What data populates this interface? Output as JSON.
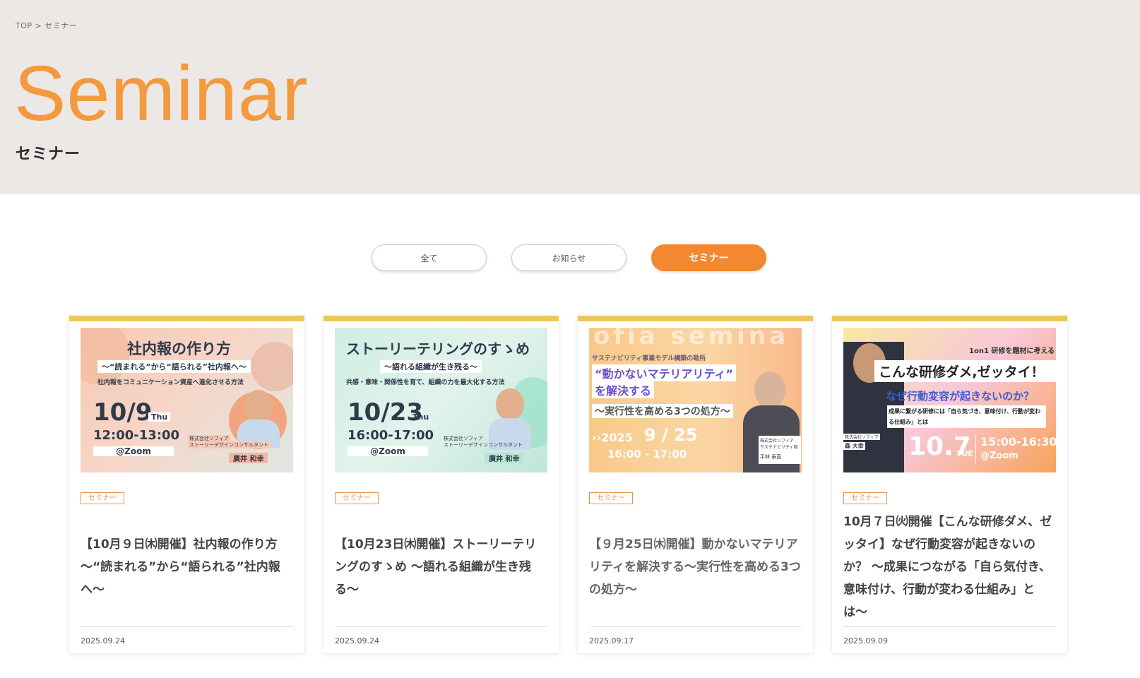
{
  "breadcrumb": {
    "home": "TOP",
    "separator": ">",
    "current": "セミナー"
  },
  "hero": {
    "title": "Seminar",
    "subtitle": "セミナー"
  },
  "filters": [
    {
      "label": "全て",
      "active": false
    },
    {
      "label": "お知らせ",
      "active": false
    },
    {
      "label": "セミナー",
      "active": true
    }
  ],
  "colors": {
    "accent": "#f28830",
    "hero_bg": "#ebe8e5",
    "card_top_border": "#efc659",
    "title_orange": "#f39a3f"
  },
  "cards": [
    {
      "tag": "セミナー",
      "title": "【10月９日㈭開催】社内報の作り方 〜“読まれる”から“語られる”社内報へ〜",
      "date": "2025.09.24",
      "thumb": {
        "headline": "社内報の作り方",
        "sub1": "〜“読まれる”から“語られる”社内報へ〜",
        "sub2": "社内報をコミュニケーション資産へ進化させる方法",
        "date": "10/9",
        "day": "Thu",
        "time": "12:00-13:00",
        "venue": "@Zoom",
        "company": "株式会社ソフィア",
        "role": "ストーリーデザインコンサルタント",
        "speaker": "廣井 和幸"
      }
    },
    {
      "tag": "セミナー",
      "title": "【10月23日㈭開催】ストーリーテリングのすゝめ 〜語れる組織が生き残る〜",
      "date": "2025.09.24",
      "thumb": {
        "headline": "ストーリーテリングのすゝめ",
        "sub1": "〜語れる組織が生き残る〜",
        "sub2": "共感・意味・関係性を育て、組織の力を最大化する方法",
        "date": "10/23",
        "day": "Thu",
        "time": "16:00-17:00",
        "venue": "@Zoom",
        "company": "株式会社ソフィア",
        "role": "ストーリーデザインコンサルタント",
        "speaker": "廣井 和幸"
      }
    },
    {
      "tag": "セミナー",
      "title": "【９月25日㈭開催】動かないマテリアリティを解決する〜実行性を高める3つの処方〜",
      "date": "2025.09.17",
      "thumb": {
        "bg_word": "ofia semina",
        "series": "サステナビリティ事業モデル構築の勘所",
        "headline1": "“動かないマテリアリティ”",
        "headline2": "を解決する",
        "sub": "〜実行性を高める3つの処方〜",
        "year": "››2025",
        "date": "9 / 25",
        "time": "16:00 - 17:00",
        "speaker_note1": "株式会社ソフィア",
        "speaker_note2": "サステナビリティ部",
        "speaker": "平林 泰直"
      }
    },
    {
      "tag": "セミナー",
      "title": "10月７日㈫開催【こんな研修ダメ、ゼッタイ】なぜ行動変容が起きないのか？ 〜成果につながる「自ら気付き、意味付け、行動が変わる仕組み」とは〜",
      "date": "2025.09.09",
      "thumb": {
        "top": "1on1 研修を題材に考える",
        "headline": "こんな研修ダメ,ゼッタイ！",
        "sub": "なぜ行動変容が起きないのか？",
        "note": "成果に繋がる研修には「自ら気づき、意味付け、行動が変わる仕組み」とは",
        "company": "株式会社ソフィア",
        "speaker": "森 大幸",
        "date": "10.7",
        "day": "TUE",
        "time": "15:00-16:30",
        "venue": "@Zoom"
      }
    }
  ]
}
